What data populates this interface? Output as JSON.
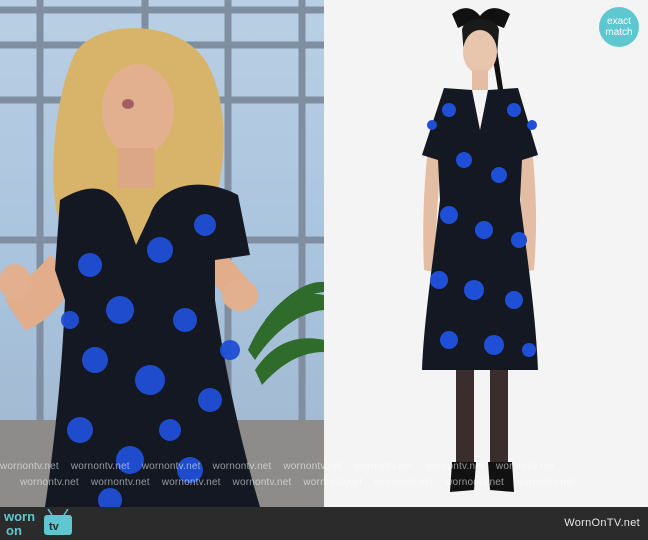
{
  "badge": {
    "line1": "exact",
    "line2": "match"
  },
  "footer": {
    "logo_top": "worn",
    "logo_bottom": "on",
    "logo_tv": "tv",
    "site": "WornOnTV.net"
  },
  "watermark": "wornontv.net",
  "colors": {
    "accent_teal": "#5fc7cf",
    "footer_bg": "#2b2b2b",
    "dress_blue": "#1f4fd6",
    "dress_black": "#141823"
  },
  "icons": {
    "tv": "tv-icon"
  }
}
